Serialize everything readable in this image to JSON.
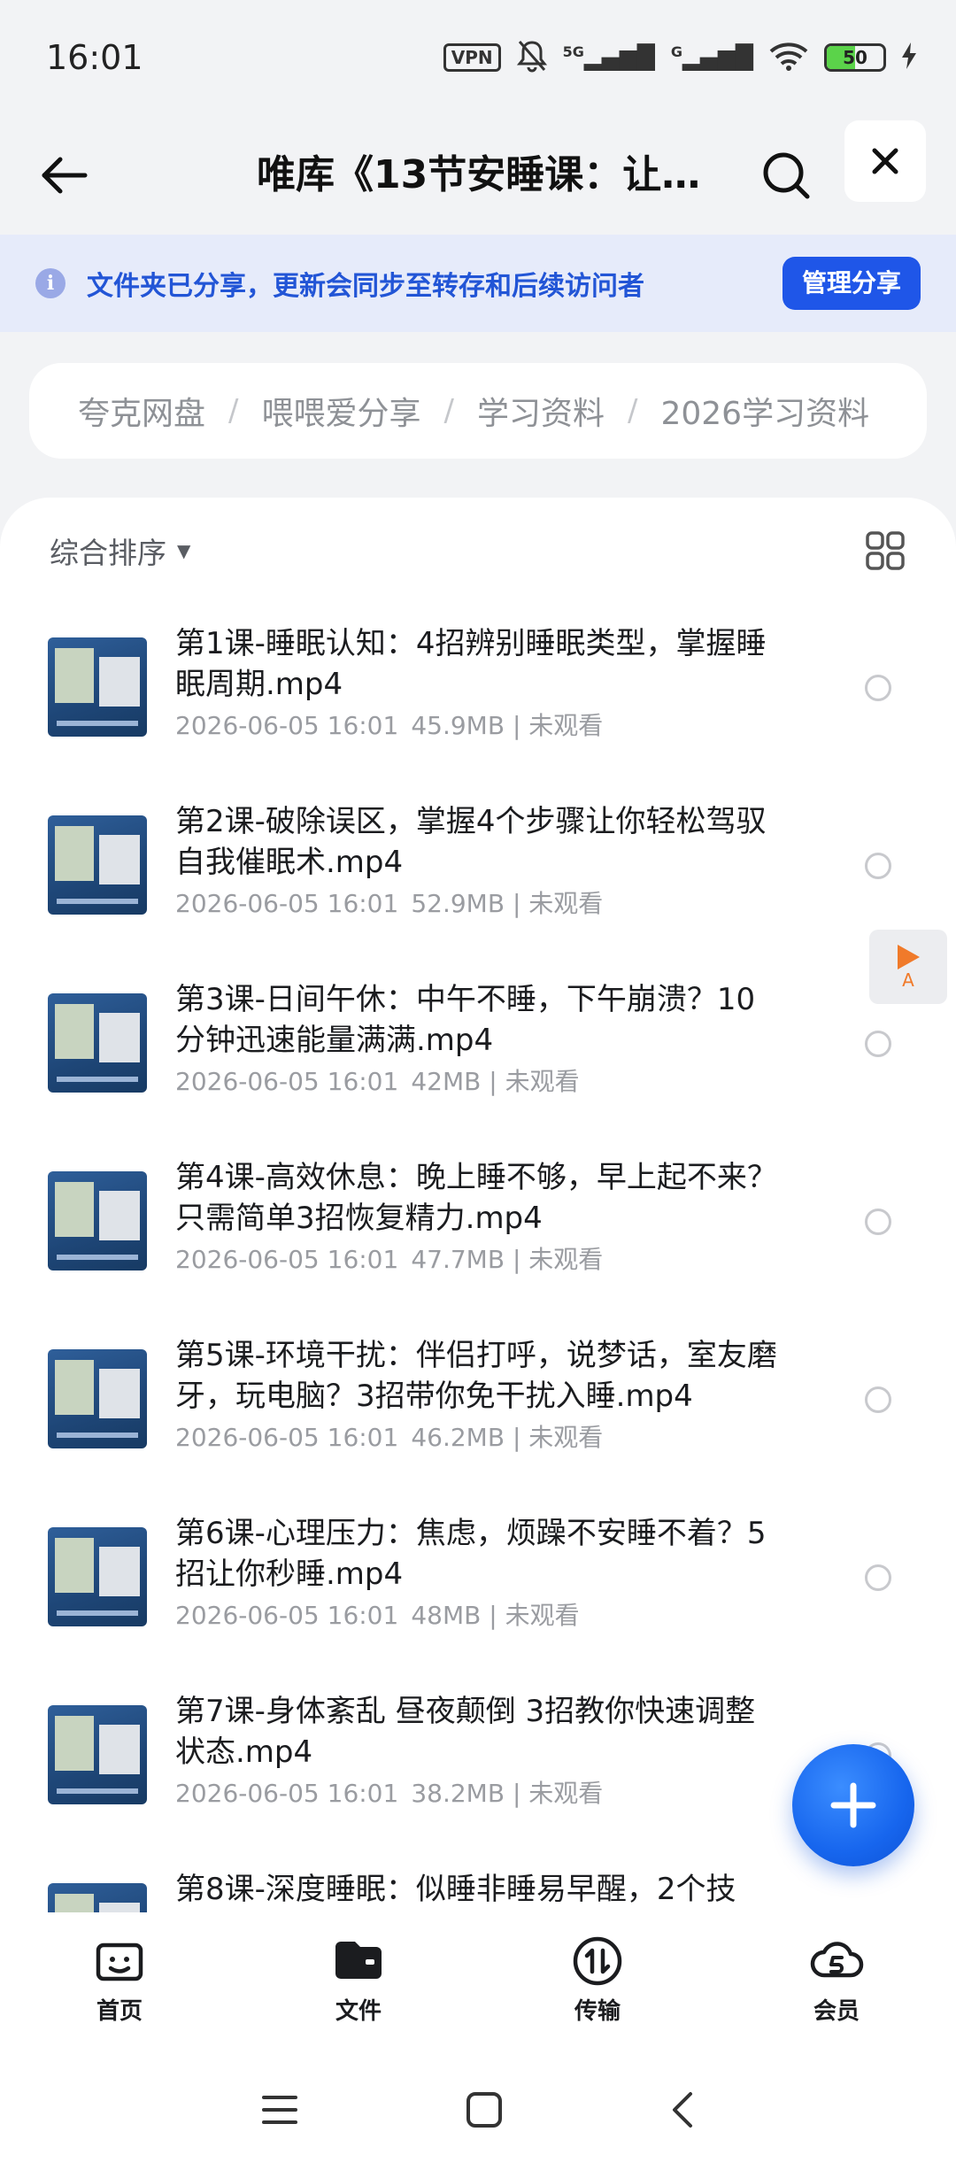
{
  "status_bar": {
    "time": "16:01",
    "vpn": "VPN",
    "network_5g": "5G",
    "network_g": "G",
    "battery": "50"
  },
  "header": {
    "title": "唯库《13节安睡课：让你…"
  },
  "banner": {
    "text": "文件夹已分享，更新会同步至转存和后续访问者",
    "button": "管理分享"
  },
  "breadcrumb": [
    "夸克网盘",
    "喂喂爱分享",
    "学习资料",
    "2026学习资料"
  ],
  "sort": {
    "label": "综合排序"
  },
  "files": [
    {
      "name": "第1课-睡眠认知：4招辨别睡眠类型，掌握睡眠周期.mp4",
      "date": "2026-06-05 16:01",
      "size": "45.9MB",
      "status": "未观看"
    },
    {
      "name": "第2课-破除误区，掌握4个步骤让你轻松驾驭自我催眠术.mp4",
      "date": "2026-06-05 16:01",
      "size": "52.9MB",
      "status": "未观看"
    },
    {
      "name": "第3课-日间午休：中午不睡，下午崩溃？10分钟迅速能量满满.mp4",
      "date": "2026-06-05 16:01",
      "size": "42MB",
      "status": "未观看"
    },
    {
      "name": "第4课-高效休息：晚上睡不够，早上起不来？只需简单3招恢复精力.mp4",
      "date": "2026-06-05 16:01",
      "size": "47.7MB",
      "status": "未观看"
    },
    {
      "name": "第5课-环境干扰：伴侣打呼，说梦话，室友磨牙，玩电脑？3招带你免干扰入睡.mp4",
      "date": "2026-06-05 16:01",
      "size": "46.2MB",
      "status": "未观看"
    },
    {
      "name": "第6课-心理压力：焦虑，烦躁不安睡不着？5招让你秒睡.mp4",
      "date": "2026-06-05 16:01",
      "size": "48MB",
      "status": "未观看"
    },
    {
      "name": "第7课-身体紊乱 昼夜颠倒 3招教你快速调整状态.mp4",
      "date": "2026-06-05 16:01",
      "size": "38.2MB",
      "status": "未观看"
    },
    {
      "name": "第8课-深度睡眠：似睡非睡易早醒，2个技",
      "date": "",
      "size": "",
      "status": ""
    }
  ],
  "mini_player": {
    "label": "A"
  },
  "bottom_nav": [
    {
      "label": "首页",
      "icon": "home-smile-icon"
    },
    {
      "label": "文件",
      "icon": "folder-icon"
    },
    {
      "label": "传输",
      "icon": "transfer-icon"
    },
    {
      "label": "会员",
      "icon": "vip-cloud-icon"
    }
  ],
  "colors": {
    "accent": "#1f56e8",
    "banner_bg": "#e6ebfa",
    "page_bg": "#f2f3f5"
  }
}
